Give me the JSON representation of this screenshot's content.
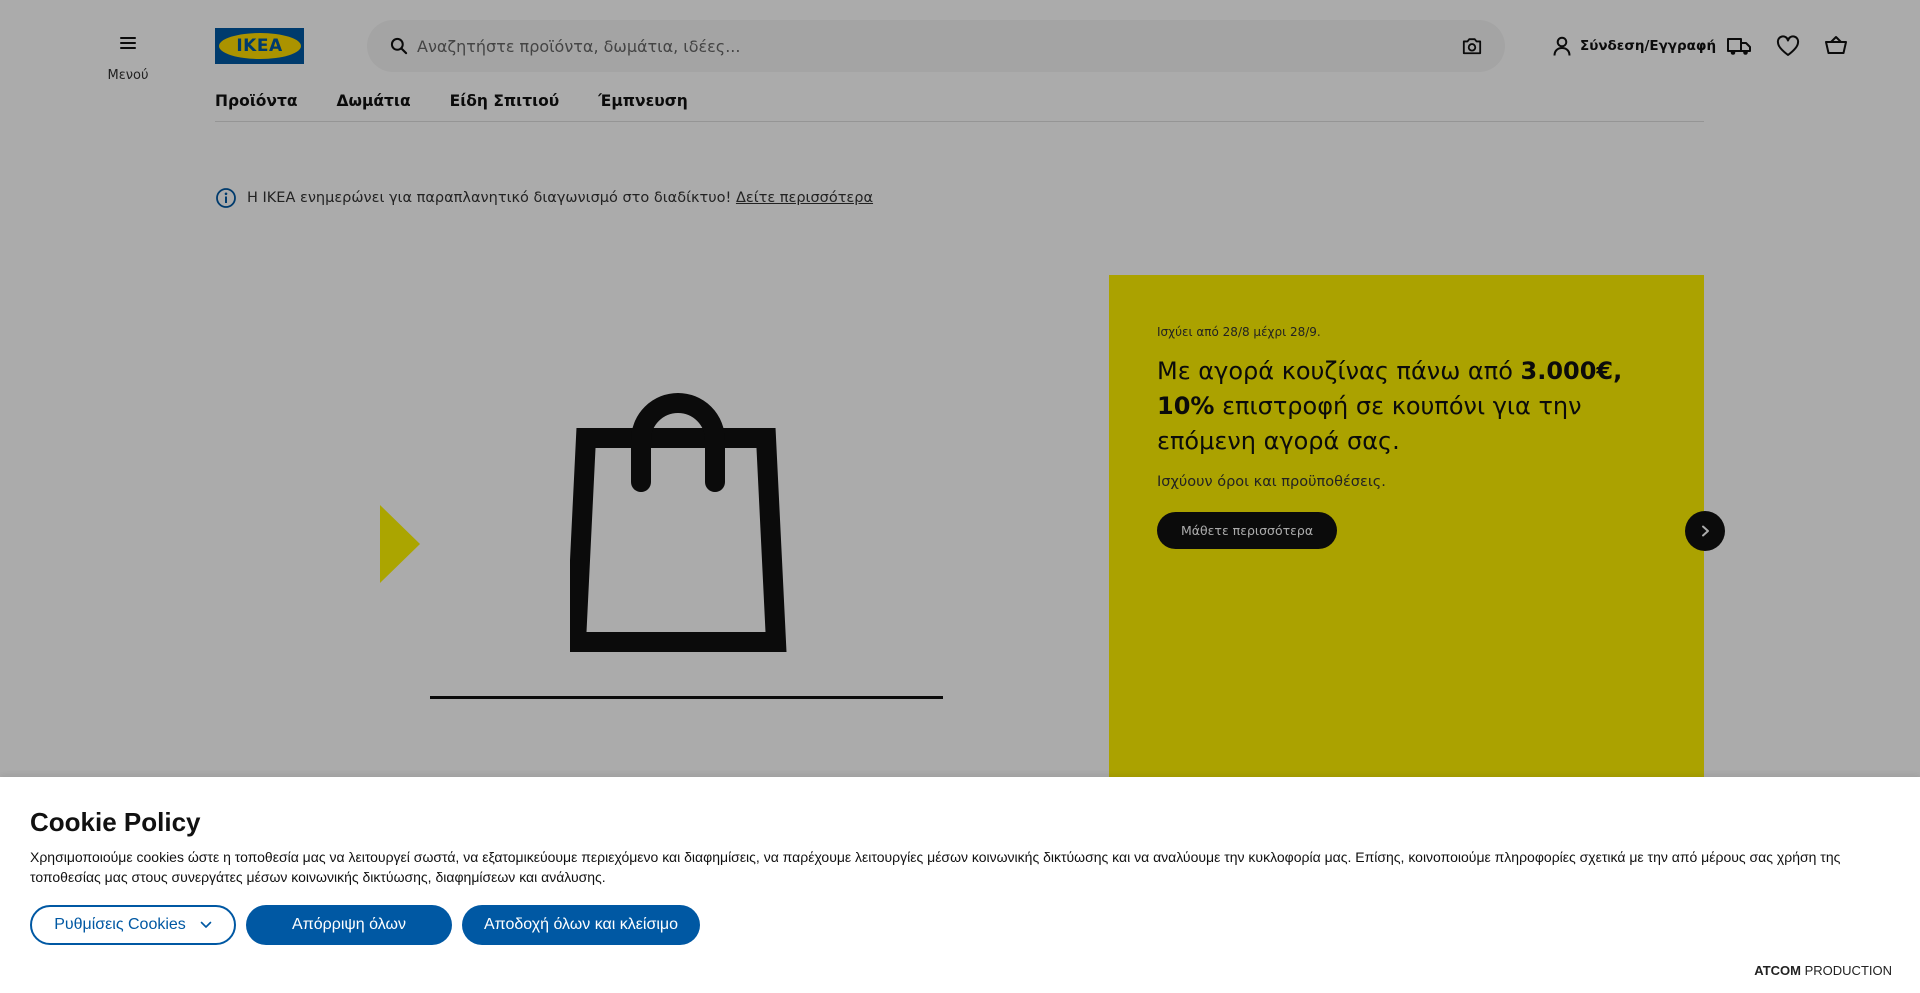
{
  "header": {
    "menu_label": "Μενού",
    "logo_text": "IKEA",
    "search_placeholder": "Αναζητήστε προϊόντα, δωμάτια, ιδέες...",
    "login_label": "Σύνδεση/Εγγραφή"
  },
  "nav": {
    "items": [
      {
        "label": "Προϊόντα"
      },
      {
        "label": "Δωμάτια"
      },
      {
        "label": "Είδη Σπιτιού"
      },
      {
        "label": "Έμπνευση"
      }
    ]
  },
  "notice": {
    "text": "Η ΙΚΕΑ ενημερώνει για παραπλανητικό διαγωνισμό στο διαδίκτυο!",
    "link": "Δείτε περισσότερα"
  },
  "promo": {
    "valid": "Ισχύει από 28/8 μέχρι 28/9.",
    "title_part1": "Με αγορά κουζίνας πάνω από ",
    "title_bold1": "3.000€, 10%",
    "title_part2": " επιστροφή σε κουπόνι για την επόμενη αγορά σας.",
    "terms": "Ισχύουν όροι και προϋποθέσεις.",
    "cta": "Μάθετε περισσότερα"
  },
  "cookie": {
    "title": "Cookie Policy",
    "text": "Χρησιμοποιούμε cookies ώστε η τοποθεσία μας να λειτουργεί σωστά, να εξατομικεύουμε περιεχόμενο και διαφημίσεις, να παρέχουμε λειτουργίες μέσων κοινωνικής δικτύωσης και να αναλύουμε την κυκλοφορία μας. Επίσης, κοινοποιούμε πληροφορίες σχετικά με την από μέρους σας χρήση της τοποθεσίας μας στους συνεργάτες μέσων κοινωνικής δικτύωσης, διαφημίσεων και ανάλυσης.",
    "settings_label": "Ρυθμίσεις Cookies",
    "reject_label": "Απόρριψη όλων",
    "accept_label": "Αποδοχή όλων και κλείσιμο"
  },
  "footer": {
    "brand_bold": "ATCOM",
    "brand_rest": " PRODUCTION"
  },
  "colors": {
    "ikea_blue": "#0058a3",
    "ikea_yellow": "#ffdb00",
    "promo_yellow": "#fff200",
    "overlay": "rgba(0,0,0,0.33)"
  }
}
